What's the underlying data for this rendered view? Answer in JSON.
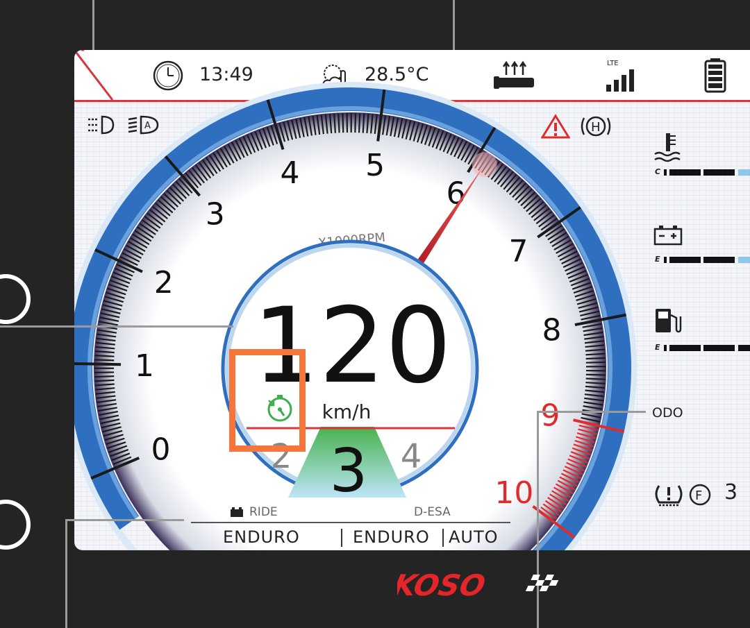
{
  "status_bar": {
    "time": "13:49",
    "temperature": "28.5°C",
    "network_label": "LTE",
    "signal_bars": 4,
    "battery_level": 1.0
  },
  "gauge": {
    "unit_label": "X1000RPM",
    "scale_min": 0,
    "scale_max": 10,
    "scale_labels": [
      "0",
      "1",
      "2",
      "3",
      "4",
      "5",
      "6",
      "7",
      "8",
      "9",
      "10"
    ],
    "redline_start": 9,
    "needle_value": 6.1
  },
  "speed": {
    "value": "120",
    "unit": "km/h"
  },
  "gear": {
    "current": "3",
    "previous": "2",
    "next": "4"
  },
  "side_bars": {
    "coolant_label": "C",
    "battery_label": "E",
    "fuel_label": "E"
  },
  "odo_label": "ODO",
  "tire_value": "3",
  "ride_mode": {
    "ride_label": "RIDE",
    "ride_value": "ENDURO",
    "desa_label": "D-ESA",
    "desa_value_1": "ENDURO",
    "desa_value_2": "AUTO"
  },
  "brand": "KOSO",
  "colors": {
    "accent_red": "#d9353a",
    "gauge_blue": "#2f6fc0",
    "gear_green": "#3cae4e",
    "highlight": "#f4763a"
  }
}
